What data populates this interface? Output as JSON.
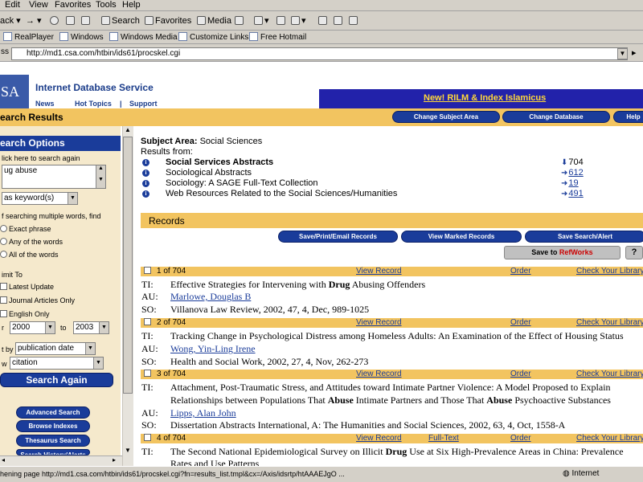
{
  "browser": {
    "menu": [
      "Edit",
      "View",
      "Favorites",
      "Tools",
      "Help"
    ],
    "toolbar": {
      "back": "ack",
      "search": "Search",
      "favorites": "Favorites",
      "media": "Media"
    },
    "links": [
      "RealPlayer",
      "Windows",
      "Windows Media",
      "Customize Links",
      "Free Hotmail"
    ],
    "address": "http://md1.csa.com/htbin/ids61/procskel.cgi",
    "status_url": "hening page http://md1.csa.com/htbin/ids61/procskel.cgi?fn=results_list.tmpl&cx=/Axis/idsrtp/htAAAEJgO ...",
    "status_zone": "Internet"
  },
  "site": {
    "logo": "SA",
    "title": "Internet Database Service",
    "nav": [
      "News",
      "Hot Topics",
      "|",
      "Support"
    ],
    "promo": "New! RILM & Index Islamicus",
    "section_title": "earch Results",
    "header_buttons": [
      "Change Subject Area",
      "Change Database",
      "Help"
    ]
  },
  "sidebar": {
    "title": "earch Options",
    "hint": "lick here to search again",
    "query": "ug  abuse",
    "search_as": "as keyword(s)",
    "multi_words_label": "f searching multiple words, find",
    "options": [
      "Exact phrase",
      "Any of the words",
      "All of the words"
    ],
    "limit_label": "imit To",
    "limits": [
      "Latest Update",
      "Journal Articles Only",
      "English Only"
    ],
    "year_from_label": "r",
    "year_from": "2000",
    "year_to_label": "to",
    "year_to": "2003",
    "sort_label": "t by",
    "sort_value": "publication date",
    "display_label": "w",
    "display_value": "citation",
    "search_again": "Search Again",
    "bottom_buttons": [
      "Advanced Search",
      "Browse Indexes",
      "Thesaurus Search",
      "Search History/Alerts"
    ]
  },
  "results": {
    "subject_label": "Subject Area:",
    "subject_value": "Social Sciences",
    "results_from": "Results from:",
    "databases": [
      {
        "name": "Social Services Abstracts",
        "count": "704",
        "bold": true
      },
      {
        "name": "Sociological Abstracts",
        "count": "612",
        "bold": false
      },
      {
        "name": "Sociology: A SAGE Full-Text Collection",
        "count": "19",
        "bold": false
      },
      {
        "name": "Web Resources Related to the Social Sciences/Humanities",
        "count": "491",
        "bold": false
      }
    ],
    "records_title": "Records",
    "record_buttons": [
      "Save/Print/Email Records",
      "View Marked Records",
      "Save Search/Alert"
    ],
    "save_to": "Save to",
    "refworks": "RefWorks",
    "help_icon": "?",
    "records": [
      {
        "num": "1 of 704",
        "actions": [
          "View Record",
          "",
          "Order",
          "Check Your Library"
        ],
        "title_pre": "Effective Strategies for Intervening with ",
        "title_bold": "Drug",
        "title_post": " Abusing Offenders",
        "title_line2_pre": "",
        "title_line2_bold": "",
        "title_line2_mid": "",
        "title_line2_bold2": "",
        "title_line2_post": "",
        "author": "Marlowe, Douglas B",
        "source": "Villanova Law Review, 2002, 47, 4, Dec, 989-1025"
      },
      {
        "num": "2 of 704",
        "actions": [
          "View Record",
          "",
          "Order",
          "Check Your Library"
        ],
        "title_pre": "Tracking Change in Psychological Distress among Homeless Adults: An Examination of the Effect of Housing Status",
        "title_bold": "",
        "title_post": "",
        "author": "Wong, Yin-Ling Irene",
        "source": "Health and Social Work, 2002, 27, 4, Nov, 262-273"
      },
      {
        "num": "3 of 704",
        "actions": [
          "View Record",
          "",
          "Order",
          "Check Your Library"
        ],
        "title_pre": "Attachment, Post-Traumatic Stress, and Attitudes toward Intimate Partner Violence: A Model Proposed to Explain",
        "title_line2_pre": "Relationships between Populations That ",
        "title_line2_bold": "Abuse",
        "title_line2_mid": " Intimate Partners and Those That ",
        "title_line2_bold2": "Abuse",
        "title_line2_post": " Psychoactive Substances",
        "author": "Lipps, Alan John",
        "source": "Dissertation Abstracts International, A: The Humanities and Social Sciences, 2002, 63, 4, Oct, 1558-A"
      },
      {
        "num": "4 of 704",
        "actions": [
          "View Record",
          "Full-Text",
          "Order",
          "Check Your Library"
        ],
        "title_pre": "The Second National Epidemiological Survey on Illicit ",
        "title_bold": "Drug",
        "title_post": " Use at Six High-Prevalence Areas in China: Prevalence",
        "title_line2": "Rates and Use Patterns"
      }
    ],
    "field_labels": {
      "ti": "TI:",
      "au": "AU:",
      "so": "SO:"
    }
  }
}
